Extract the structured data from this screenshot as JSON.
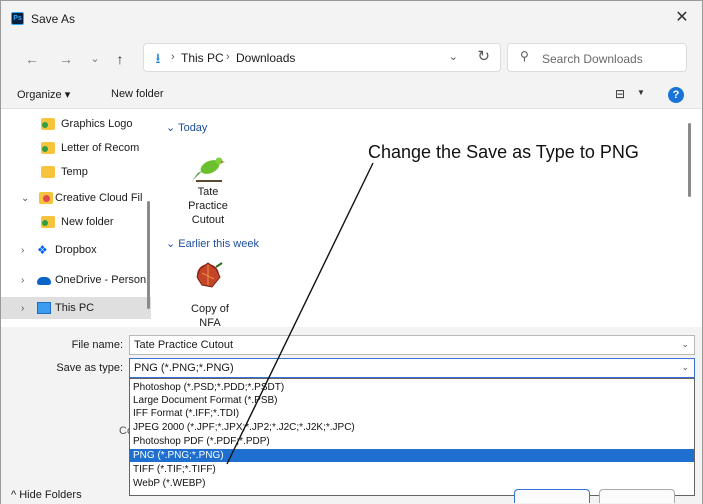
{
  "window": {
    "app_icon": "Ps",
    "title": "Save As",
    "close_glyph": "✕"
  },
  "nav": {
    "back_glyph": "←",
    "forward_glyph": "→",
    "recent_glyph": "⌄",
    "up_glyph": "↑"
  },
  "address": {
    "download_glyph": "⭳",
    "separator": "›",
    "crumbs": [
      "This PC",
      "Downloads"
    ],
    "chevron_glyph": "⌄",
    "refresh_glyph": "↻"
  },
  "search": {
    "icon_glyph": "⚲",
    "placeholder": "Search Downloads"
  },
  "toolbar": {
    "organize_label": "Organize ▾",
    "new_folder_label": "New folder",
    "view_glyph": "⊟",
    "view_chevron": "▼",
    "help_glyph": "?"
  },
  "sidebar": {
    "items": [
      {
        "label": "Graphics Logo",
        "icon": "green-folder-icon"
      },
      {
        "label": "Letter of Recom",
        "icon": "green-folder-icon"
      },
      {
        "label": "Temp",
        "icon": "folder-icon"
      },
      {
        "label": "Creative Cloud Fil",
        "icon": "creative-cloud-folder-icon",
        "expander": "⌄"
      },
      {
        "label": "New folder",
        "icon": "green-folder-icon"
      },
      {
        "label": "Dropbox",
        "icon": "dropbox-icon",
        "expander": "›"
      },
      {
        "label": "OneDrive - Person",
        "icon": "onedrive-icon",
        "expander": "›"
      },
      {
        "label": "This PC",
        "icon": "this-pc-icon",
        "expander": "›",
        "selected": true
      }
    ]
  },
  "content": {
    "groups": [
      {
        "header": "⌄ Today",
        "files": [
          {
            "label_lines": [
              "Tate",
              "Practice",
              "Cutout"
            ],
            "icon": "parrot-thumbnail"
          }
        ]
      },
      {
        "header": "⌄ Earlier this week",
        "files": [
          {
            "label_lines": [
              "Copy of",
              "NFA"
            ],
            "icon": "leaf-thumbnail"
          }
        ]
      }
    ]
  },
  "annotation": "Change the Save as Type to PNG",
  "form": {
    "file_name_label": "File name:",
    "file_name_value": "Tate Practice Cutout",
    "save_type_label": "Save as type:",
    "save_type_value": "PNG (*.PNG;*.PNG)",
    "chevron_glyph": "⌄",
    "partial_text": "Co"
  },
  "type_options": [
    "Photoshop (*.PSD;*.PDD;*.PSDT)",
    "Large Document Format (*.PSB)",
    "IFF Format (*.IFF;*.TDI)",
    "JPEG 2000 (*.JPF;*.JPX;*.JP2;*.J2C;*.J2K;*.JPC)",
    "Photoshop PDF (*.PDF;*.PDP)",
    "PNG (*.PNG;*.PNG)",
    "TIFF (*.TIF;*.TIFF)",
    "WebP (*.WEBP)"
  ],
  "selected_option_index": 5,
  "footer": {
    "hide_folders_label": "^ Hide Folders"
  },
  "colors": {
    "accent": "#1f6fd0",
    "window_bg": "#f3f3f3",
    "link_blue": "#1e4e9c"
  }
}
